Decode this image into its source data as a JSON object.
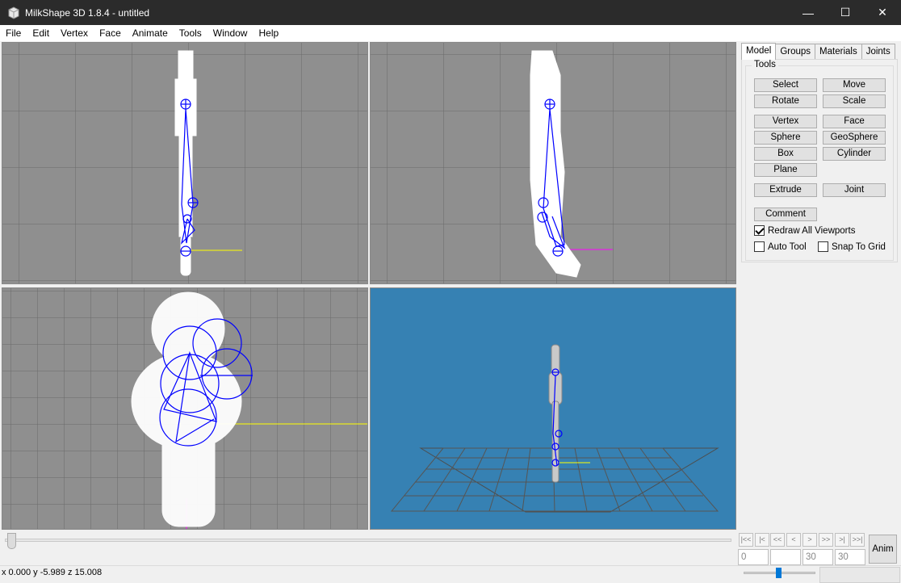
{
  "window": {
    "title": "MilkShape 3D 1.8.4 - untitled",
    "minimize": "—",
    "maximize": "☐",
    "close": "✕"
  },
  "menu": [
    "File",
    "Edit",
    "Vertex",
    "Face",
    "Animate",
    "Tools",
    "Window",
    "Help"
  ],
  "tabs": [
    "Model",
    "Groups",
    "Materials",
    "Joints"
  ],
  "tools": {
    "label": "Tools",
    "buttons": {
      "select": "Select",
      "move": "Move",
      "rotate": "Rotate",
      "scale": "Scale",
      "vertex": "Vertex",
      "face": "Face",
      "sphere": "Sphere",
      "geosphere": "GeoSphere",
      "box": "Box",
      "cylinder": "Cylinder",
      "plane": "Plane",
      "extrude": "Extrude",
      "joint": "Joint",
      "comment": "Comment"
    },
    "checkboxes": {
      "redraw": {
        "label": "Redraw All Viewports",
        "checked": true
      },
      "auto_tool": {
        "label": "Auto Tool",
        "checked": false
      },
      "snap": {
        "label": "Snap To Grid",
        "checked": false
      }
    }
  },
  "timeline": {
    "nav": [
      "|<<",
      "|<",
      "<<",
      "<",
      ">",
      ">>",
      ">|",
      ">>|"
    ],
    "frame_current": "0",
    "frame_blank": "",
    "frame_a": "30",
    "frame_b": "30",
    "anim_label": "Anim"
  },
  "status": {
    "coords": "x 0.000 y -5.989 z 15.008"
  },
  "colors": {
    "viewport_gray": "#8f8f8f",
    "viewport_blue": "#3681b3",
    "joint_blue": "#0000ff",
    "axis_yellow": "#ffff00",
    "axis_magenta": "#ff00ff"
  }
}
